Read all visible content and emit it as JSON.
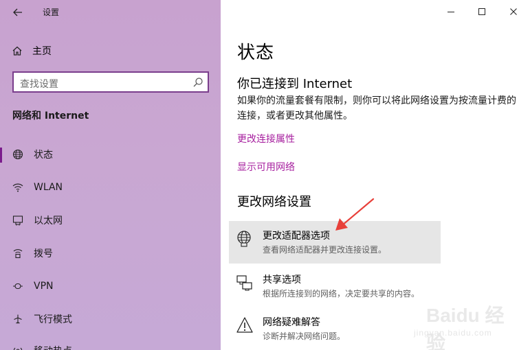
{
  "window": {
    "title": "设置",
    "controls": {
      "minimize": "minimize",
      "maximize": "maximize",
      "close": "close"
    }
  },
  "sidebar": {
    "home_label": "主页",
    "search_placeholder": "查找设置",
    "section_title": "网络和 Internet",
    "items": [
      {
        "label": "状态",
        "icon": "globe-icon",
        "active": true
      },
      {
        "label": "WLAN",
        "icon": "wifi-icon",
        "active": false
      },
      {
        "label": "以太网",
        "icon": "ethernet-icon",
        "active": false
      },
      {
        "label": "拨号",
        "icon": "dialup-icon",
        "active": false
      },
      {
        "label": "VPN",
        "icon": "vpn-icon",
        "active": false
      },
      {
        "label": "飞行模式",
        "icon": "airplane-icon",
        "active": false
      },
      {
        "label": "移动热点",
        "icon": "hotspot-icon",
        "active": false
      }
    ]
  },
  "main": {
    "title": "状态",
    "connection_heading": "你已连接到 Internet",
    "connection_desc": "如果你的流量套餐有限制，则你可以将此网络设置为按流量计费的连接，或者更改其他属性。",
    "links": {
      "change_properties": "更改连接属性",
      "show_networks": "显示可用网络"
    },
    "change_heading": "更改网络设置",
    "options": [
      {
        "title": "更改适配器选项",
        "desc": "查看网络适配器并更改连接设置。",
        "icon": "adapter-globe-icon",
        "highlight": true
      },
      {
        "title": "共享选项",
        "desc": "根据所连接到的网络，决定要共享的内容。",
        "icon": "sharing-icon",
        "highlight": false
      },
      {
        "title": "网络疑难解答",
        "desc": "诊断并解决网络问题。",
        "icon": "warning-icon",
        "highlight": false
      }
    ]
  },
  "annotation": {
    "arrow_color": "#e8403a"
  },
  "watermark": {
    "brand": "Baidu 经验",
    "site": "jingyan.baidu.com"
  },
  "colors": {
    "accent": "#a7209f",
    "active_bar": "#7a1c8c",
    "search_border": "#7a3d8c",
    "highlight": "#e6e6e6"
  }
}
